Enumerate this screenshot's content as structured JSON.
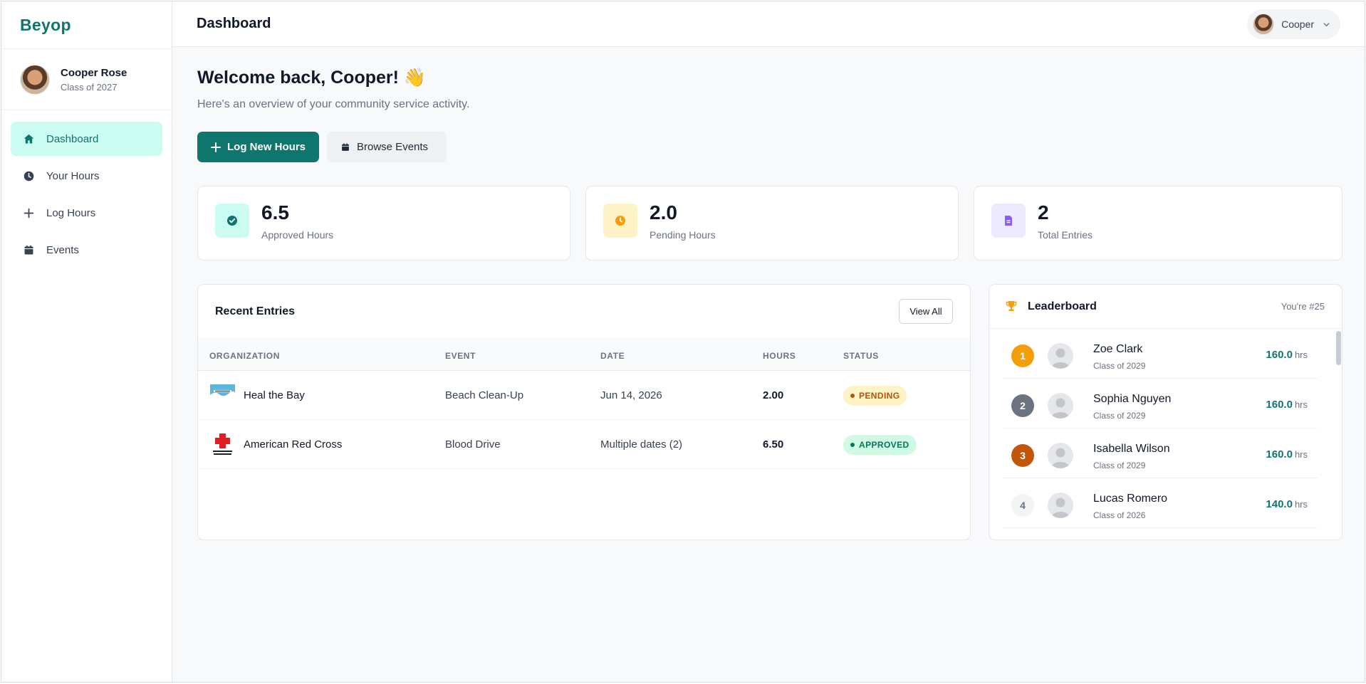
{
  "app": {
    "brand": "Beyop"
  },
  "sidebar": {
    "user": {
      "name": "Cooper Rose",
      "class": "Class of 2027"
    },
    "items": [
      {
        "label": "Dashboard",
        "icon": "home-icon",
        "active": true
      },
      {
        "label": "Your Hours",
        "icon": "clock-icon",
        "active": false
      },
      {
        "label": "Log Hours",
        "icon": "plus-icon",
        "active": false
      },
      {
        "label": "Events",
        "icon": "calendar-icon",
        "active": false
      }
    ]
  },
  "header": {
    "title": "Dashboard",
    "user_name": "Cooper"
  },
  "main": {
    "welcome": "Welcome back, Cooper! 👋",
    "subtitle": "Here's an overview of your community service activity.",
    "log_button": "Log New Hours",
    "browse_button": "Browse Events"
  },
  "stats": [
    {
      "value": "6.5",
      "label": "Approved Hours",
      "icon": "check-circle-icon",
      "bg": "#ccfbf1",
      "color": "#0f766e"
    },
    {
      "value": "2.0",
      "label": "Pending Hours",
      "icon": "clock-icon",
      "bg": "#fef3c7",
      "color": "#f59e0b"
    },
    {
      "value": "2",
      "label": "Total Entries",
      "icon": "document-icon",
      "bg": "#ede9fe",
      "color": "#8b5cf6"
    }
  ],
  "recent": {
    "title": "Recent Entries",
    "view_all": "View All",
    "columns": [
      "ORGANIZATION",
      "EVENT",
      "DATE",
      "HOURS",
      "STATUS"
    ],
    "rows": [
      {
        "org": "Heal the Bay",
        "event": "Beach Clean-Up",
        "date": "Jun 14, 2026",
        "hours": "2.00",
        "status": "PENDING",
        "logo_text": "Heal the Bay"
      },
      {
        "org": "American Red Cross",
        "event": "Blood Drive",
        "date": "Multiple dates (2)",
        "hours": "6.50",
        "status": "APPROVED",
        "logo_text": "American Red Cross"
      }
    ]
  },
  "leaderboard": {
    "title": "Leaderboard",
    "your_rank": "You're #25",
    "unit": "hrs",
    "entries": [
      {
        "rank": "1",
        "name": "Zoe Clark",
        "class": "Class of 2029",
        "hours": "160.0",
        "color": "#f59e0b"
      },
      {
        "rank": "2",
        "name": "Sophia Nguyen",
        "class": "Class of 2029",
        "hours": "160.0",
        "color": "#6b7280"
      },
      {
        "rank": "3",
        "name": "Isabella Wilson",
        "class": "Class of 2029",
        "hours": "160.0",
        "color": "#c2570c"
      },
      {
        "rank": "4",
        "name": "Lucas Romero",
        "class": "Class of 2026",
        "hours": "140.0",
        "color": "#f3f4f6"
      }
    ]
  }
}
